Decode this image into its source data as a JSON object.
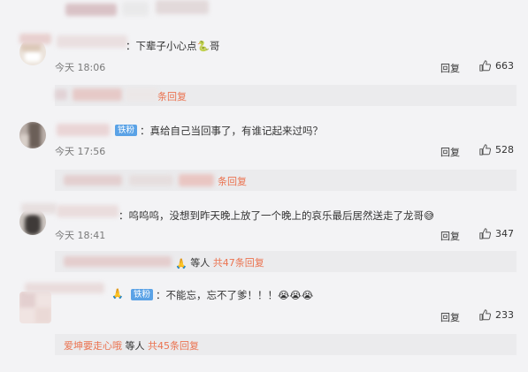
{
  "colors": {
    "accent": "#eb7350",
    "fans_badge": "#5aa2e6",
    "background": "#f3f3f5",
    "sub_bg": "#ebebed"
  },
  "top_partial_text": "",
  "comments": [
    {
      "text": "：下辈子小心点🐍哥",
      "time": "今天 18:06",
      "reply_label": "回复",
      "likes": "663",
      "sub_link": "",
      "sub_others": "",
      "sub_count": "条回复"
    },
    {
      "badge": "铁粉",
      "text": "：真给自己当回事了，有谁记起来过吗？",
      "time": "今天 17:56",
      "reply_label": "回复",
      "likes": "528",
      "sub_count": "条回复"
    },
    {
      "text": "：呜呜呜，没想到昨天晚上放了一个晚上的哀乐最后居然送走了龙哥😅",
      "time": "今天 18:41",
      "reply_label": "回复",
      "likes": "347",
      "sub_others": "等人",
      "sub_count": "共47条回复"
    },
    {
      "badge": "铁粉",
      "text": "：不能忘，忘不了爹！！！😭😭😭",
      "time": "今天 18:23",
      "reply_label": "回复",
      "likes": "233",
      "sub_link": "爱坤要走心哦",
      "sub_others": "等人",
      "sub_count": "共45条回复"
    }
  ],
  "icons": {
    "like": "thumbs-up-icon"
  }
}
